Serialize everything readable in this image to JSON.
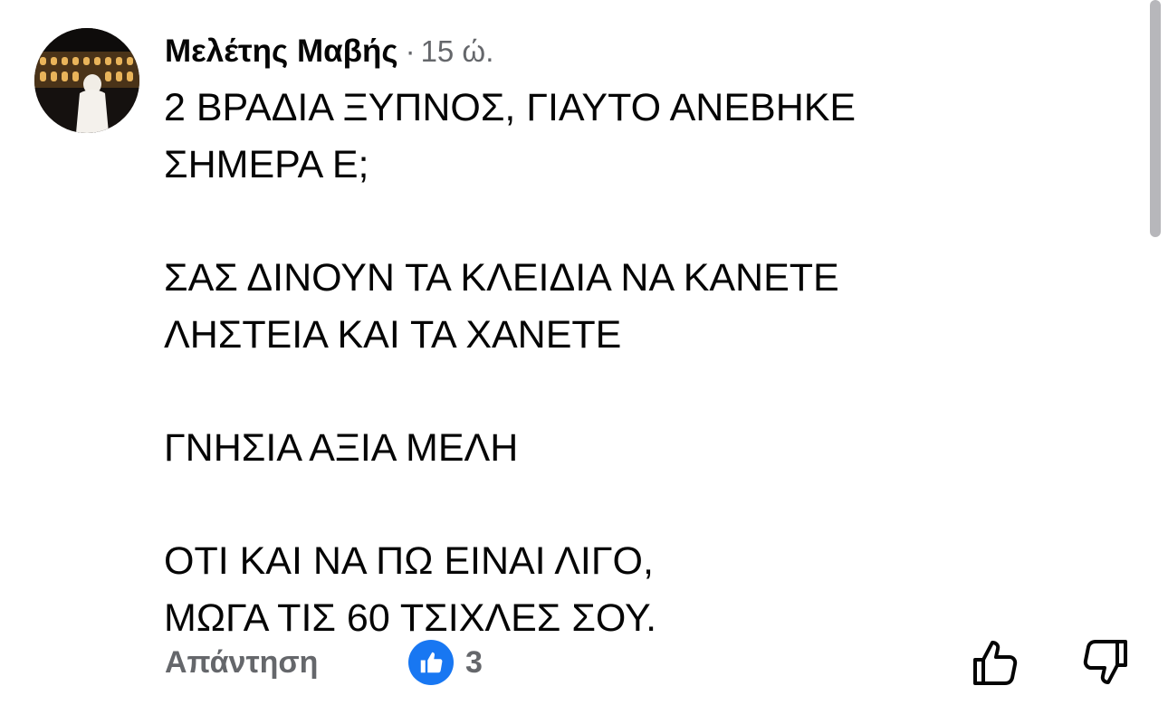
{
  "comment": {
    "author": "Μελέτης Μαβής",
    "separator": "·",
    "timestamp": "15 ώ.",
    "avatar_icon": "profile-photo-colosseum-night",
    "text_lines": [
      "2 ΒΡΑΔΙΑ ΞΥΠΝΟΣ, ΓΙΑΥΤΟ ΑΝΕΒΗΚΕ",
      "ΣΗΜΕΡΑ Ε;",
      "",
      "ΣΑΣ ΔΙΝΟΥΝ ΤΑ ΚΛΕΙΔΙΑ ΝΑ ΚΑΝΕΤΕ",
      "ΛΗΣΤΕΙΑ ΚΑΙ ΤΑ ΧΑΝΕΤΕ",
      "",
      "ΓΝΗΣΙΑ ΑΞΙΑ ΜΕΛΗ",
      "",
      "ΟΤΙ ΚΑΙ ΝΑ ΠΩ ΕΙΝΑΙ ΛΙΓΟ,",
      "ΜΩΓΑ ΤΙΣ 60 ΤΣΙΧΛΕΣ ΣΟΥ."
    ]
  },
  "actions": {
    "reply_label": "Απάντηση",
    "reaction_icon": "like-icon",
    "reaction_count": "3",
    "upvote_icon": "thumbs-up-outline-icon",
    "downvote_icon": "thumbs-down-outline-icon"
  },
  "colors": {
    "text_primary": "#050505",
    "text_secondary": "#65676b",
    "like_blue": "#1877f2"
  }
}
